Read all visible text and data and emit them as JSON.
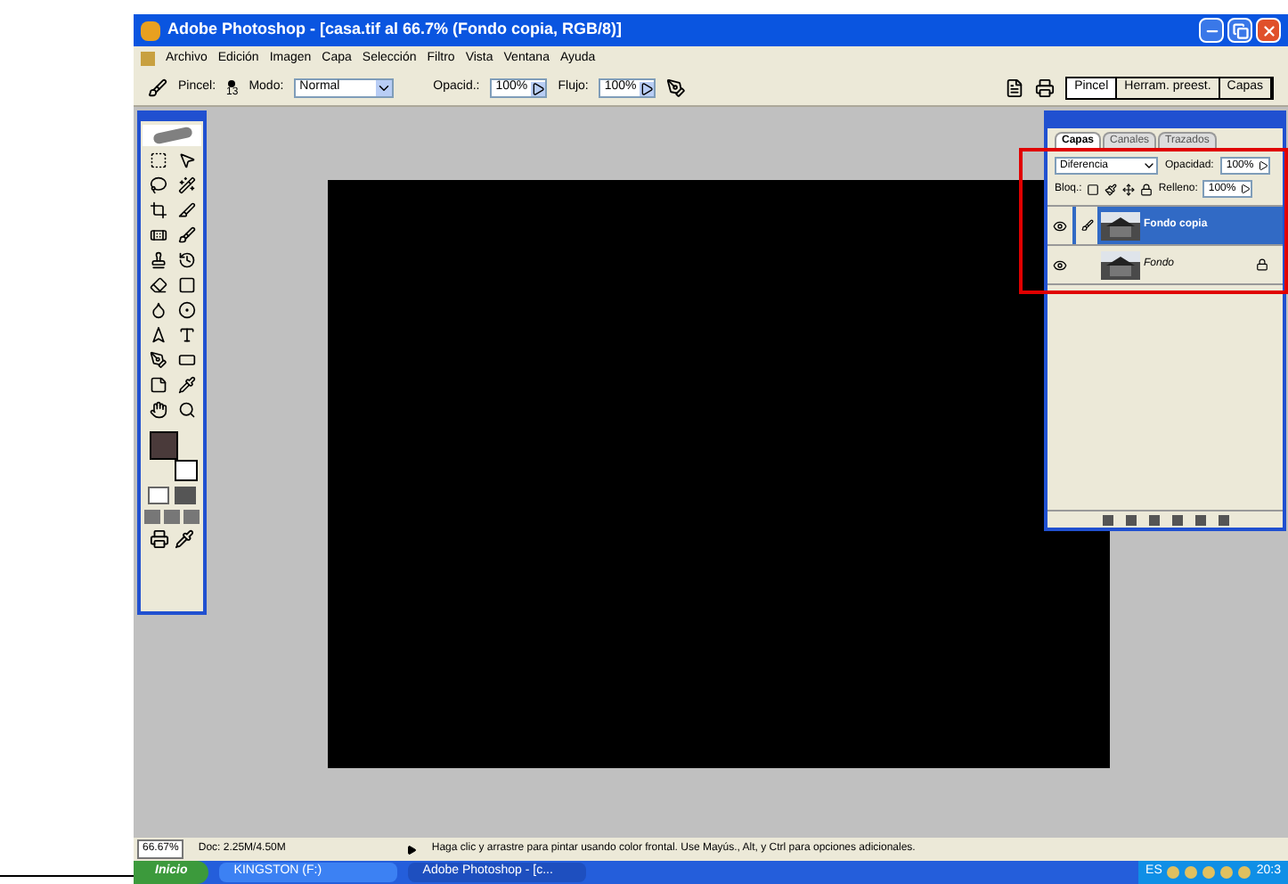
{
  "window": {
    "title": "Adobe Photoshop - [casa.tif al 66.7% (Fondo copia, RGB/8)]"
  },
  "menu": [
    "Archivo",
    "Edición",
    "Imagen",
    "Capa",
    "Selección",
    "Filtro",
    "Vista",
    "Ventana",
    "Ayuda"
  ],
  "options_bar": {
    "brush_label": "Pincel:",
    "brush_size": "13",
    "mode_label": "Modo:",
    "mode_value": "Normal",
    "opacity_label": "Opacid.:",
    "opacity_value": "100%",
    "flow_label": "Flujo:",
    "flow_value": "100%",
    "well_tabs": [
      {
        "label": "Pincel",
        "selected": true
      },
      {
        "label": "Herram. preest.",
        "selected": false
      },
      {
        "label": "Capas",
        "selected": false
      }
    ]
  },
  "layers_panel": {
    "tabs": [
      {
        "label": "Capas",
        "selected": true
      },
      {
        "label": "Canales",
        "selected": false
      },
      {
        "label": "Trazados",
        "selected": false
      }
    ],
    "blend_mode": "Diferencia",
    "opacity_label": "Opacidad:",
    "opacity_value": "100%",
    "lock_label": "Bloq.:",
    "fill_label": "Relleno:",
    "fill_value": "100%",
    "layers": [
      {
        "name": "Fondo copia",
        "selected": true,
        "visible": true,
        "locked": false
      },
      {
        "name": "Fondo",
        "selected": false,
        "visible": true,
        "locked": true
      }
    ]
  },
  "annotation": {
    "kind": "red-rectangle"
  },
  "status_bar": {
    "zoom": "66.67%",
    "doc": "Doc: 2.25M/4.50M",
    "hint": "Haga clic y arrastre para pintar usando color frontal. Use Mayús., Alt, y Ctrl para opciones adicionales."
  },
  "taskbar": {
    "start": "Inicio",
    "tasks": [
      {
        "label": "KINGSTON (F:)",
        "selected": false
      },
      {
        "label": "Adobe Photoshop - [c...",
        "selected": true
      }
    ],
    "language": "ES",
    "clock": "20:3"
  }
}
